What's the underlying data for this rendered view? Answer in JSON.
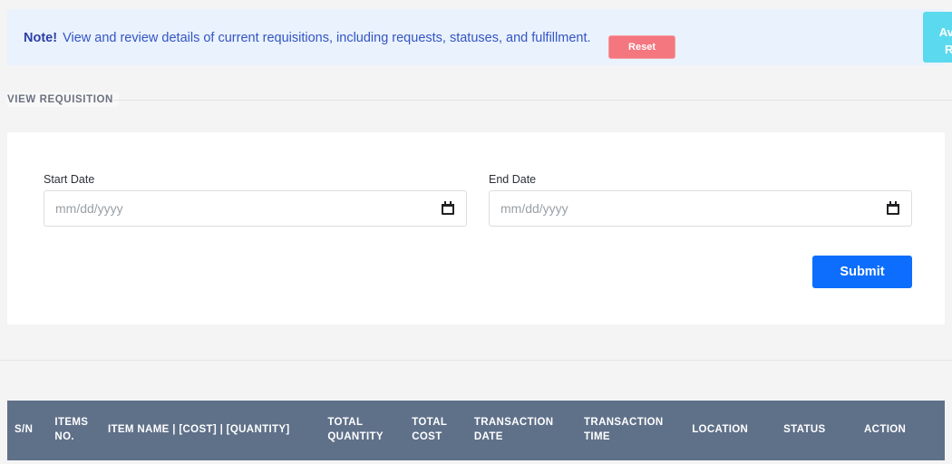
{
  "alert": {
    "note_label": "Note!",
    "message": "View and review details of current requisitions, including requests, statuses, and fulfillment.",
    "reset_label": "Reset",
    "available_rooms_label": "Available Rooms",
    "background_color": "#eaf2fd",
    "text_color": "#3355c4",
    "reset_color": "#f4767e",
    "available_rooms_color": "#5bd9ef"
  },
  "section": {
    "title": "VIEW REQUISITION"
  },
  "form": {
    "start_date": {
      "label": "Start Date",
      "placeholder": "mm/dd/yyyy",
      "value": ""
    },
    "end_date": {
      "label": "End Date",
      "placeholder": "mm/dd/yyyy",
      "value": ""
    },
    "submit_label": "Submit",
    "submit_color": "#0d6efd"
  },
  "table": {
    "header_color": "#5f7089",
    "columns": [
      {
        "key": "sn",
        "label": "S/N"
      },
      {
        "key": "items_no",
        "label": "ITEMS NO."
      },
      {
        "key": "item_name",
        "label": "ITEM NAME | [COST] | [QUANTITY]"
      },
      {
        "key": "total_quantity",
        "label": "TOTAL QUANTITY"
      },
      {
        "key": "total_cost",
        "label": "TOTAL COST"
      },
      {
        "key": "transaction_date",
        "label": "TRANSACTION DATE"
      },
      {
        "key": "transaction_time",
        "label": "TRANSACTION TIME"
      },
      {
        "key": "location",
        "label": "LOCATION"
      },
      {
        "key": "status",
        "label": "STATUS"
      },
      {
        "key": "action",
        "label": "ACTION"
      }
    ],
    "rows": []
  }
}
